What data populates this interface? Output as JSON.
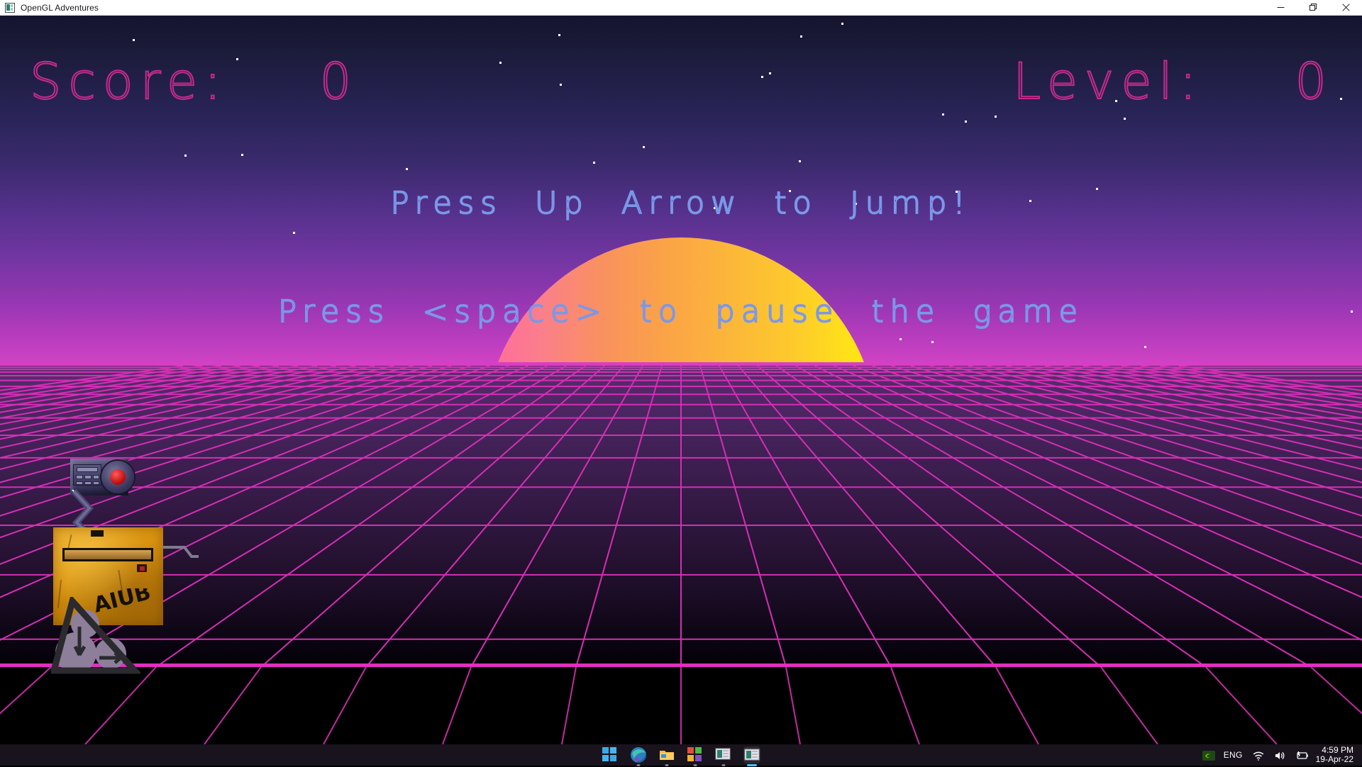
{
  "window": {
    "title": "OpenGL Adventures",
    "icon": "opengl-app-icon",
    "controls": [
      {
        "name": "minimize",
        "glyph": "—"
      },
      {
        "name": "maximize",
        "glyph": "❐"
      },
      {
        "name": "close",
        "glyph": "✕"
      }
    ]
  },
  "hud": {
    "score_label": "Score:",
    "score_value": "0",
    "score_text": "Score:    0",
    "level_label": "Level:",
    "level_value": "0",
    "level_text": "Level:    0",
    "color": "#c62a8c"
  },
  "instructions": {
    "line1": "Press  Up  Arrow  to  Jump!",
    "line2": "Press  <space>  to  pause  the  game",
    "color": "#7b98e8"
  },
  "scene": {
    "theme": "synthwave-retro-sunset",
    "sky_top_color": "#14142e",
    "sky_bottom_color": "#d243c4",
    "sun_left_color": "#ff6a9e",
    "sun_right_color": "#ffe808",
    "grid_line_color": "#d42fb4",
    "horizon_color": "#d63fc4",
    "ground_top_color": "#5b2c70",
    "ground_bottom_color": "#030107",
    "pit_color": "#000000",
    "star_count": 34
  },
  "player": {
    "name": "crate-robot",
    "crate_label": "AIUB",
    "crate_color": "#d9920f",
    "head_lens_color": "#c00d0d",
    "wheel_color": "#8d7f9a"
  },
  "taskbar": {
    "items": [
      {
        "name": "start-button",
        "label": "Start"
      },
      {
        "name": "edge-browser",
        "label": "Microsoft Edge"
      },
      {
        "name": "file-explorer",
        "label": "File Explorer"
      },
      {
        "name": "microsoft-store",
        "label": "Microsoft Store"
      },
      {
        "name": "app-window-1",
        "label": "App"
      },
      {
        "name": "opengl-adventures-window",
        "label": "OpenGL Adventures"
      }
    ],
    "tray": {
      "nvidia": "nvidia-icon",
      "language": "ENG",
      "wifi": "wifi-icon",
      "volume": "volume-icon",
      "battery": "battery-charging-icon"
    },
    "clock": {
      "time": "4:59 PM",
      "date": "19-Apr-22"
    }
  }
}
